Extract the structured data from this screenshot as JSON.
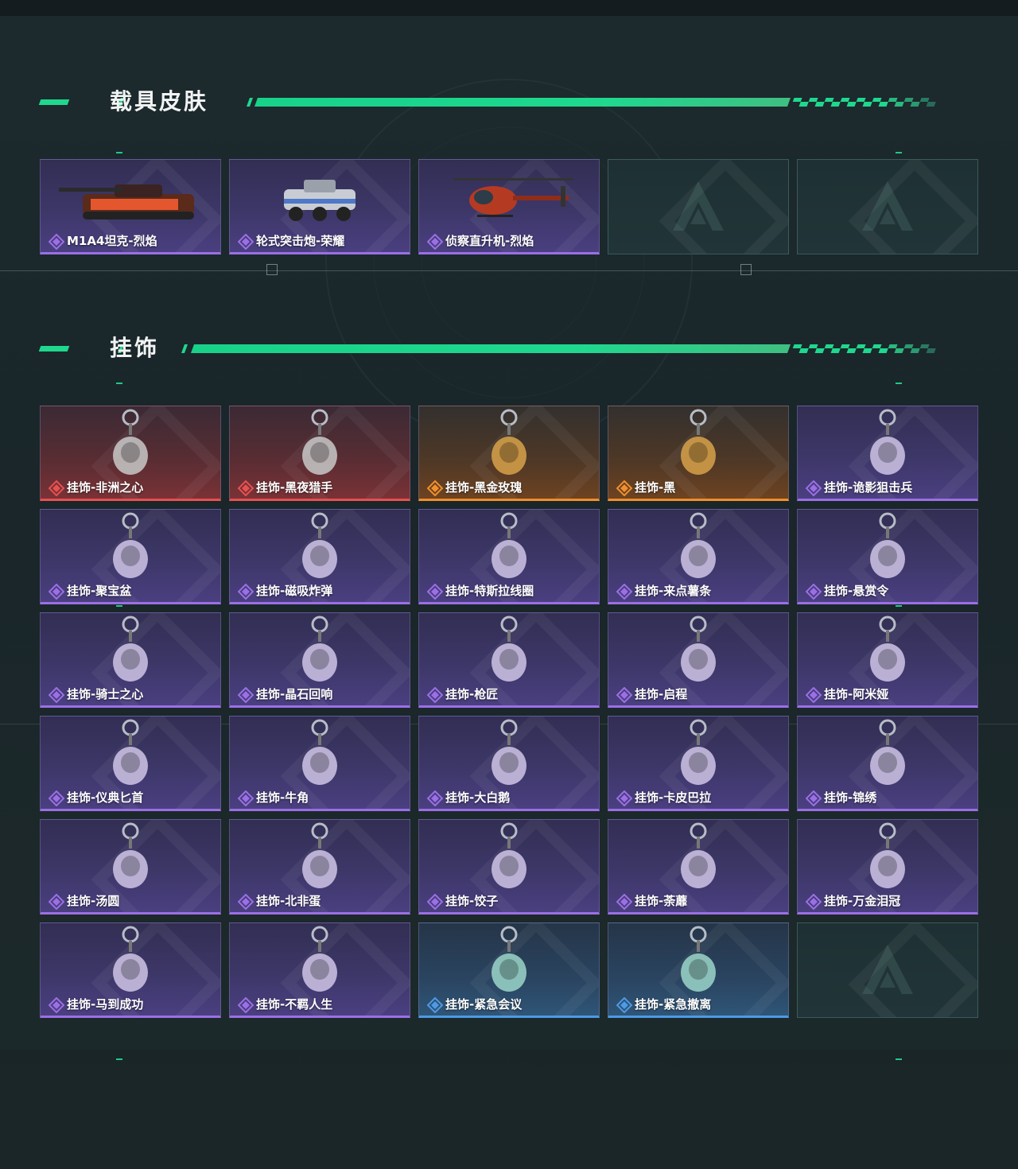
{
  "sections": {
    "vehicle": {
      "title": "载具皮肤",
      "items": [
        {
          "name": "M1A4坦克-烈焰",
          "rarity": "purple",
          "icon": "tank-icon"
        },
        {
          "name": "轮式突击炮-荣耀",
          "rarity": "purple",
          "icon": "armored-car-icon"
        },
        {
          "name": "侦察直升机-烈焰",
          "rarity": "purple",
          "icon": "helicopter-icon"
        },
        {
          "name": "",
          "rarity": "empty",
          "icon": "logo-placeholder-icon"
        },
        {
          "name": "",
          "rarity": "empty",
          "icon": "logo-placeholder-icon"
        }
      ]
    },
    "charms": {
      "title": "挂饰",
      "items": [
        {
          "name": "挂饰-非洲之心",
          "rarity": "red",
          "icon": "heart-gem-charm-icon"
        },
        {
          "name": "挂饰-黑夜猎手",
          "rarity": "red",
          "icon": "figure-charm-icon"
        },
        {
          "name": "挂饰-黑金玫瑰",
          "rarity": "orange",
          "icon": "rose-charm-icon"
        },
        {
          "name": "挂饰-黑",
          "rarity": "orange",
          "icon": "tag-charm-icon"
        },
        {
          "name": "挂饰-诡影狙击兵",
          "rarity": "purple",
          "icon": "sniper-charm-icon"
        },
        {
          "name": "挂饰-聚宝盆",
          "rarity": "purple",
          "icon": "treasure-bowl-charm-icon"
        },
        {
          "name": "挂饰-磁吸炸弹",
          "rarity": "purple",
          "icon": "bomb-charm-icon"
        },
        {
          "name": "挂饰-特斯拉线圈",
          "rarity": "purple",
          "icon": "tesla-coil-charm-icon"
        },
        {
          "name": "挂饰-来点薯条",
          "rarity": "purple",
          "icon": "fries-charm-icon"
        },
        {
          "name": "挂饰-悬赏令",
          "rarity": "purple",
          "icon": "wanted-poster-charm-icon"
        },
        {
          "name": "挂饰-骑士之心",
          "rarity": "purple",
          "icon": "knight-heart-charm-icon"
        },
        {
          "name": "挂饰-晶石回响",
          "rarity": "purple",
          "icon": "crystal-charm-icon"
        },
        {
          "name": "挂饰-枪匠",
          "rarity": "purple",
          "icon": "gunsmith-charm-icon"
        },
        {
          "name": "挂饰-启程",
          "rarity": "purple",
          "icon": "badge-charm-icon"
        },
        {
          "name": "挂饰-阿米娅",
          "rarity": "purple",
          "icon": "amiya-charm-icon"
        },
        {
          "name": "挂饰-仪典匕首",
          "rarity": "purple",
          "icon": "dagger-charm-icon"
        },
        {
          "name": "挂饰-牛角",
          "rarity": "purple",
          "icon": "horns-charm-icon"
        },
        {
          "name": "挂饰-大白鹅",
          "rarity": "purple",
          "icon": "goose-charm-icon"
        },
        {
          "name": "挂饰-卡皮巴拉",
          "rarity": "purple",
          "icon": "capybara-charm-icon"
        },
        {
          "name": "挂饰-锦绣",
          "rarity": "purple",
          "icon": "butterfly-charm-icon"
        },
        {
          "name": "挂饰-汤圆",
          "rarity": "purple",
          "icon": "tangyuan-charm-icon"
        },
        {
          "name": "挂饰-北非蛋",
          "rarity": "purple",
          "icon": "shakshuka-charm-icon"
        },
        {
          "name": "挂饰-饺子",
          "rarity": "purple",
          "icon": "dumpling-charm-icon"
        },
        {
          "name": "挂饰-荼蘼",
          "rarity": "purple",
          "icon": "flower-charm-icon"
        },
        {
          "name": "挂饰-万金泪冠",
          "rarity": "purple",
          "icon": "crown-charm-icon"
        },
        {
          "name": "挂饰-马到成功",
          "rarity": "purple",
          "icon": "horse-charm-icon"
        },
        {
          "name": "挂饰-不羁人生",
          "rarity": "purple",
          "icon": "sneaker-charm-icon"
        },
        {
          "name": "挂饰-紧急会议",
          "rarity": "blue",
          "icon": "meeting-charm-icon"
        },
        {
          "name": "挂饰-紧急撤离",
          "rarity": "blue",
          "icon": "evac-charm-icon"
        },
        {
          "name": "",
          "rarity": "empty",
          "icon": "logo-placeholder-icon"
        }
      ]
    }
  },
  "colors": {
    "accent": "#1fd88e",
    "purple": "#9b6fe6",
    "red": "#e85050",
    "orange": "#f08f2c",
    "blue": "#4d9ae6"
  }
}
